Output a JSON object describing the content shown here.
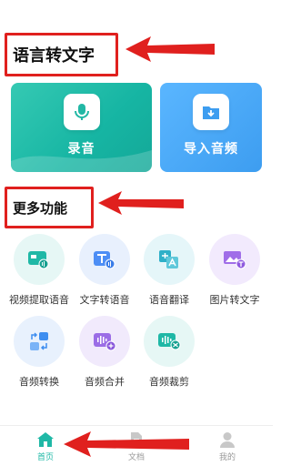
{
  "sections": {
    "speech_to_text_title": "语言转文字",
    "more_features_title": "更多功能"
  },
  "cards": [
    {
      "label": "录音",
      "icon": "microphone-icon"
    },
    {
      "label": "导入音频",
      "icon": "folder-download-icon"
    }
  ],
  "features": [
    {
      "label": "视频提取语音",
      "icon": "video-extract-icon",
      "color": "#1fb8a6",
      "bg": "#e6f7f5"
    },
    {
      "label": "文字转语音",
      "icon": "text-to-speech-icon",
      "color": "#4d8ef5",
      "bg": "#e8f0fd"
    },
    {
      "label": "语音翻译",
      "icon": "translate-icon",
      "color": "#2fb0c8",
      "bg": "#e5f6f9"
    },
    {
      "label": "图片转文字",
      "icon": "image-to-text-icon",
      "color": "#a06ee8",
      "bg": "#f2eafd"
    },
    {
      "label": "音频转换",
      "icon": "audio-convert-icon",
      "color": "#3e8ef0",
      "bg": "#e8f1fd"
    },
    {
      "label": "音频合并",
      "icon": "audio-merge-icon",
      "color": "#9b6de6",
      "bg": "#f1eafc"
    },
    {
      "label": "音频裁剪",
      "icon": "audio-cut-icon",
      "color": "#1fb8a6",
      "bg": "#e6f7f5"
    }
  ],
  "tabbar": [
    {
      "label": "首页",
      "icon": "home-icon",
      "active": true
    },
    {
      "label": "文档",
      "icon": "document-icon",
      "active": false
    },
    {
      "label": "我的",
      "icon": "profile-icon",
      "active": false
    }
  ],
  "colors": {
    "accent": "#1fb8a6",
    "annotation_red": "#e0201e"
  }
}
